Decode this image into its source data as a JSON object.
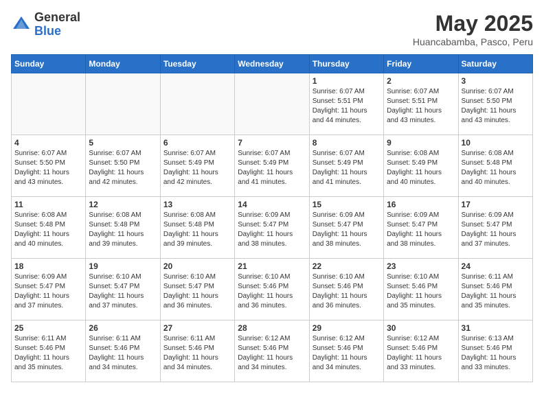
{
  "header": {
    "logo_line1": "General",
    "logo_line2": "Blue",
    "month_title": "May 2025",
    "location": "Huancabamba, Pasco, Peru"
  },
  "days_of_week": [
    "Sunday",
    "Monday",
    "Tuesday",
    "Wednesday",
    "Thursday",
    "Friday",
    "Saturday"
  ],
  "weeks": [
    [
      {
        "day": "",
        "info": "",
        "empty": true
      },
      {
        "day": "",
        "info": "",
        "empty": true
      },
      {
        "day": "",
        "info": "",
        "empty": true
      },
      {
        "day": "",
        "info": "",
        "empty": true
      },
      {
        "day": "1",
        "info": "Sunrise: 6:07 AM\nSunset: 5:51 PM\nDaylight: 11 hours\nand 44 minutes."
      },
      {
        "day": "2",
        "info": "Sunrise: 6:07 AM\nSunset: 5:51 PM\nDaylight: 11 hours\nand 43 minutes."
      },
      {
        "day": "3",
        "info": "Sunrise: 6:07 AM\nSunset: 5:50 PM\nDaylight: 11 hours\nand 43 minutes."
      }
    ],
    [
      {
        "day": "4",
        "info": "Sunrise: 6:07 AM\nSunset: 5:50 PM\nDaylight: 11 hours\nand 43 minutes."
      },
      {
        "day": "5",
        "info": "Sunrise: 6:07 AM\nSunset: 5:50 PM\nDaylight: 11 hours\nand 42 minutes."
      },
      {
        "day": "6",
        "info": "Sunrise: 6:07 AM\nSunset: 5:49 PM\nDaylight: 11 hours\nand 42 minutes."
      },
      {
        "day": "7",
        "info": "Sunrise: 6:07 AM\nSunset: 5:49 PM\nDaylight: 11 hours\nand 41 minutes."
      },
      {
        "day": "8",
        "info": "Sunrise: 6:07 AM\nSunset: 5:49 PM\nDaylight: 11 hours\nand 41 minutes."
      },
      {
        "day": "9",
        "info": "Sunrise: 6:08 AM\nSunset: 5:49 PM\nDaylight: 11 hours\nand 40 minutes."
      },
      {
        "day": "10",
        "info": "Sunrise: 6:08 AM\nSunset: 5:48 PM\nDaylight: 11 hours\nand 40 minutes."
      }
    ],
    [
      {
        "day": "11",
        "info": "Sunrise: 6:08 AM\nSunset: 5:48 PM\nDaylight: 11 hours\nand 40 minutes."
      },
      {
        "day": "12",
        "info": "Sunrise: 6:08 AM\nSunset: 5:48 PM\nDaylight: 11 hours\nand 39 minutes."
      },
      {
        "day": "13",
        "info": "Sunrise: 6:08 AM\nSunset: 5:48 PM\nDaylight: 11 hours\nand 39 minutes."
      },
      {
        "day": "14",
        "info": "Sunrise: 6:09 AM\nSunset: 5:47 PM\nDaylight: 11 hours\nand 38 minutes."
      },
      {
        "day": "15",
        "info": "Sunrise: 6:09 AM\nSunset: 5:47 PM\nDaylight: 11 hours\nand 38 minutes."
      },
      {
        "day": "16",
        "info": "Sunrise: 6:09 AM\nSunset: 5:47 PM\nDaylight: 11 hours\nand 38 minutes."
      },
      {
        "day": "17",
        "info": "Sunrise: 6:09 AM\nSunset: 5:47 PM\nDaylight: 11 hours\nand 37 minutes."
      }
    ],
    [
      {
        "day": "18",
        "info": "Sunrise: 6:09 AM\nSunset: 5:47 PM\nDaylight: 11 hours\nand 37 minutes."
      },
      {
        "day": "19",
        "info": "Sunrise: 6:10 AM\nSunset: 5:47 PM\nDaylight: 11 hours\nand 37 minutes."
      },
      {
        "day": "20",
        "info": "Sunrise: 6:10 AM\nSunset: 5:47 PM\nDaylight: 11 hours\nand 36 minutes."
      },
      {
        "day": "21",
        "info": "Sunrise: 6:10 AM\nSunset: 5:46 PM\nDaylight: 11 hours\nand 36 minutes."
      },
      {
        "day": "22",
        "info": "Sunrise: 6:10 AM\nSunset: 5:46 PM\nDaylight: 11 hours\nand 36 minutes."
      },
      {
        "day": "23",
        "info": "Sunrise: 6:10 AM\nSunset: 5:46 PM\nDaylight: 11 hours\nand 35 minutes."
      },
      {
        "day": "24",
        "info": "Sunrise: 6:11 AM\nSunset: 5:46 PM\nDaylight: 11 hours\nand 35 minutes."
      }
    ],
    [
      {
        "day": "25",
        "info": "Sunrise: 6:11 AM\nSunset: 5:46 PM\nDaylight: 11 hours\nand 35 minutes."
      },
      {
        "day": "26",
        "info": "Sunrise: 6:11 AM\nSunset: 5:46 PM\nDaylight: 11 hours\nand 34 minutes."
      },
      {
        "day": "27",
        "info": "Sunrise: 6:11 AM\nSunset: 5:46 PM\nDaylight: 11 hours\nand 34 minutes."
      },
      {
        "day": "28",
        "info": "Sunrise: 6:12 AM\nSunset: 5:46 PM\nDaylight: 11 hours\nand 34 minutes."
      },
      {
        "day": "29",
        "info": "Sunrise: 6:12 AM\nSunset: 5:46 PM\nDaylight: 11 hours\nand 34 minutes."
      },
      {
        "day": "30",
        "info": "Sunrise: 6:12 AM\nSunset: 5:46 PM\nDaylight: 11 hours\nand 33 minutes."
      },
      {
        "day": "31",
        "info": "Sunrise: 6:13 AM\nSunset: 5:46 PM\nDaylight: 11 hours\nand 33 minutes."
      }
    ]
  ]
}
